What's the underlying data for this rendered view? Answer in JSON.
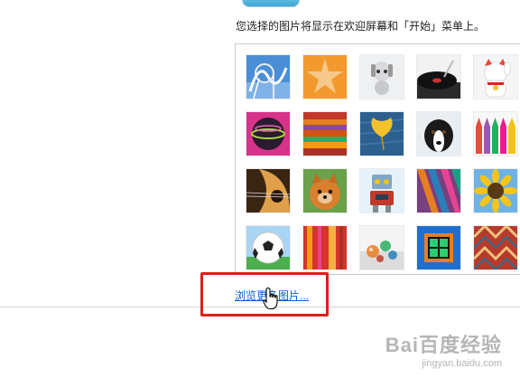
{
  "description": "您选择的图片将显示在欢迎屏幕和「开始」菜单上。",
  "browse_link": "浏览更多图片...",
  "gallery": {
    "rows": [
      [
        "roller-coaster",
        "starfish",
        "robot-dog",
        "turntable",
        "lucky-cat"
      ],
      [
        "bowling-ball",
        "fabric-stripes",
        "ginkgo-leaf",
        "border-collie",
        "crayons"
      ],
      [
        "guitar",
        "pomeranian",
        "toy-robot",
        "scarves",
        "sunflower"
      ],
      [
        "soccer-ball",
        "red-fabric",
        "marbles",
        "green-window",
        "woven-rug"
      ]
    ]
  },
  "watermark": {
    "brand": "Bai百度经验",
    "url": "jingyan.baidu.com"
  },
  "colors": {
    "highlight": "#e31b1b",
    "link": "#0b5ed7"
  }
}
